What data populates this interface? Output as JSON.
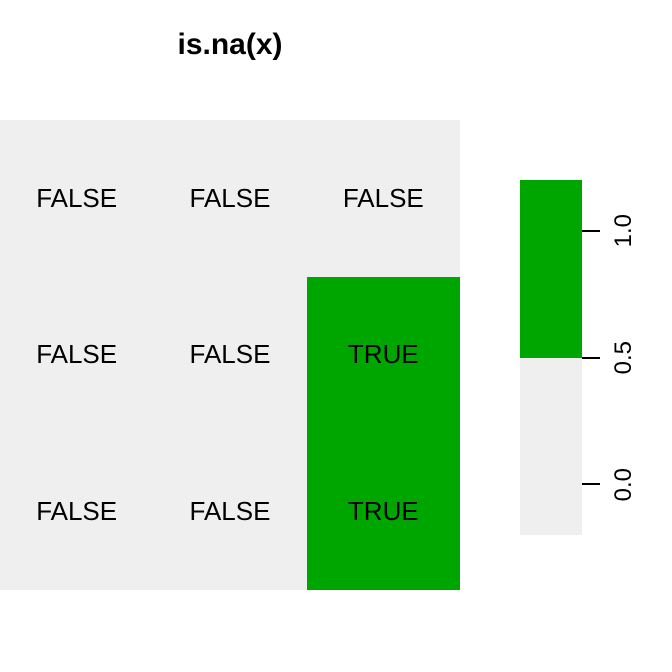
{
  "chart_data": {
    "type": "heatmap",
    "title": "is.na(x)",
    "rows": 3,
    "cols": 3,
    "cell_labels": [
      [
        "FALSE",
        "FALSE",
        "FALSE"
      ],
      [
        "FALSE",
        "FALSE",
        "TRUE"
      ],
      [
        "FALSE",
        "FALSE",
        "TRUE"
      ]
    ],
    "cell_values": [
      [
        0,
        0,
        0
      ],
      [
        0,
        0,
        1
      ],
      [
        0,
        0,
        1
      ]
    ],
    "colorscale": {
      "low_value": 0,
      "high_value": 1,
      "low_color": "#efefef",
      "high_color": "#00a600"
    },
    "legend_ticks": [
      "0.0",
      "0.5",
      "1.0"
    ]
  }
}
